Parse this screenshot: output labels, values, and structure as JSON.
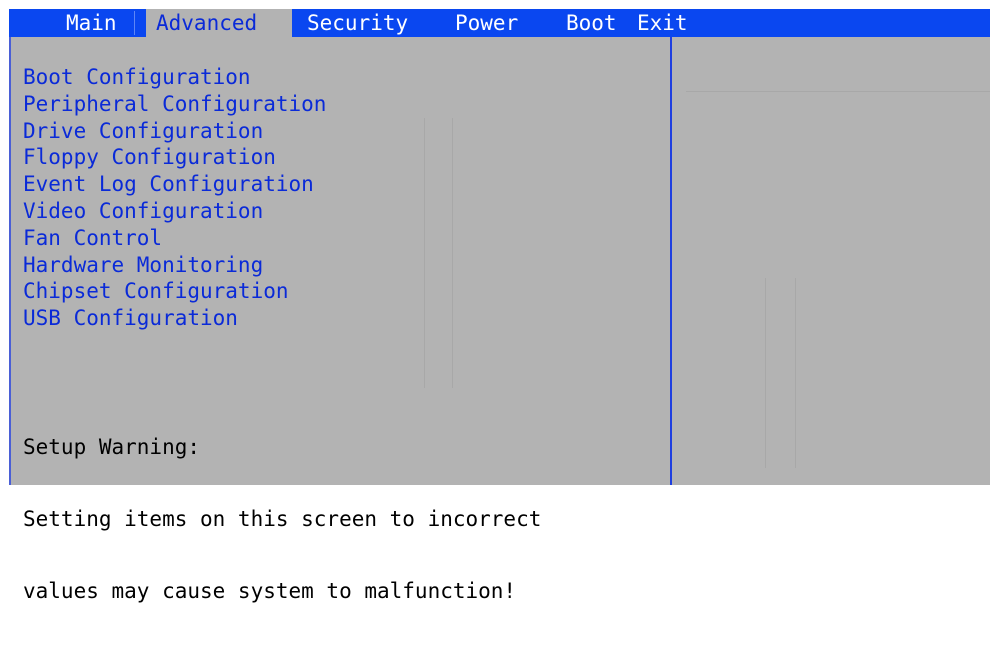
{
  "menubar": {
    "tabs": [
      {
        "label": "Main",
        "active": false
      },
      {
        "label": "Advanced",
        "active": true
      },
      {
        "label": "Security",
        "active": false
      },
      {
        "label": "Power",
        "active": false
      },
      {
        "label": "Boot",
        "active": false
      },
      {
        "label": "Exit",
        "active": false
      }
    ]
  },
  "advanced": {
    "items": [
      "Boot Configuration",
      "Peripheral Configuration",
      "Drive Configuration",
      "Floppy Configuration",
      "Event Log Configuration",
      "Video Configuration",
      "Fan Control",
      "Hardware Monitoring",
      "Chipset Configuration",
      "USB Configuration"
    ],
    "warning": {
      "title": "Setup Warning:",
      "line1": "Setting items on this screen to incorrect",
      "line2": "values may cause system to malfunction!"
    }
  },
  "colors": {
    "menubar_bg": "#0a47f0",
    "panel_bg": "#b3b3b3",
    "item_text": "#0a2ad8",
    "tab_text": "#ffffff",
    "warning_text": "#000000"
  }
}
